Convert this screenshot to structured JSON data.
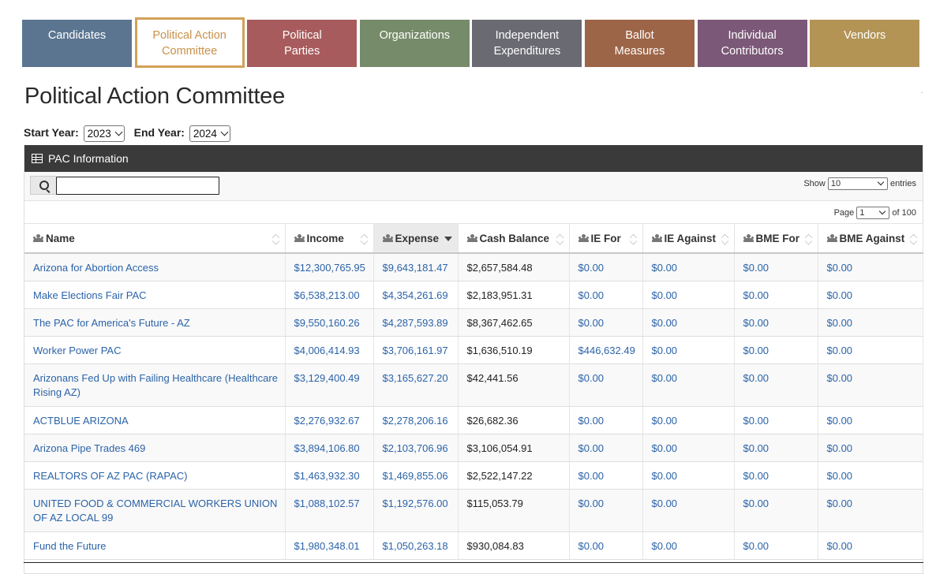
{
  "nav_tabs": [
    {
      "label": "Candidates",
      "color": "#5b7591",
      "active": false
    },
    {
      "label": "Political Action\nCommittee",
      "color": "#ffffff",
      "active": true
    },
    {
      "label": "Political\nParties",
      "color": "#a85b5c",
      "active": false
    },
    {
      "label": "Organizations",
      "color": "#768b6a",
      "active": false
    },
    {
      "label": "Independent\nExpenditures",
      "color": "#6a6a72",
      "active": false
    },
    {
      "label": "Ballot\nMeasures",
      "color": "#9d6547",
      "active": false
    },
    {
      "label": "Individual\nContributors",
      "color": "#7b5877",
      "active": false
    },
    {
      "label": "Vendors",
      "color": "#b39455",
      "active": false
    }
  ],
  "page_title": "Political Action Committee",
  "filters": {
    "start_label": "Start Year:",
    "start_value": "2023",
    "end_label": "End Year:",
    "end_value": "2024"
  },
  "panel": {
    "title": "PAC Information",
    "show_label": "Show",
    "show_value": "10",
    "entries_label": "entries",
    "page_label": "Page",
    "page_value": "1",
    "page_of": "of 100"
  },
  "table": {
    "columns": [
      "Name",
      "Income",
      "Expense",
      "Cash Balance",
      "IE For",
      "IE Against",
      "BME For",
      "BME Against"
    ],
    "sorted_column": "Expense",
    "rows": [
      {
        "name": "Arizona for Abortion Access",
        "income": "$12,300,765.95",
        "expense": "$9,643,181.47",
        "cash": "$2,657,584.48",
        "ie_for": "$0.00",
        "ie_against": "$0.00",
        "bme_for": "$0.00",
        "bme_against": "$0.00"
      },
      {
        "name": "Make Elections Fair PAC",
        "income": "$6,538,213.00",
        "expense": "$4,354,261.69",
        "cash": "$2,183,951.31",
        "ie_for": "$0.00",
        "ie_against": "$0.00",
        "bme_for": "$0.00",
        "bme_against": "$0.00"
      },
      {
        "name": "The PAC for America's Future - AZ",
        "income": "$9,550,160.26",
        "expense": "$4,287,593.89",
        "cash": "$8,367,462.65",
        "ie_for": "$0.00",
        "ie_against": "$0.00",
        "bme_for": "$0.00",
        "bme_against": "$0.00"
      },
      {
        "name": "Worker Power PAC",
        "income": "$4,006,414.93",
        "expense": "$3,706,161.97",
        "cash": "$1,636,510.19",
        "ie_for": "$446,632.49",
        "ie_against": "$0.00",
        "bme_for": "$0.00",
        "bme_against": "$0.00"
      },
      {
        "name": "Arizonans Fed Up with Failing Healthcare (Healthcare Rising AZ)",
        "income": "$3,129,400.49",
        "expense": "$3,165,627.20",
        "cash": "$42,441.56",
        "ie_for": "$0.00",
        "ie_against": "$0.00",
        "bme_for": "$0.00",
        "bme_against": "$0.00"
      },
      {
        "name": "ACTBLUE ARIZONA",
        "income": "$2,276,932.67",
        "expense": "$2,278,206.16",
        "cash": "$26,682.36",
        "ie_for": "$0.00",
        "ie_against": "$0.00",
        "bme_for": "$0.00",
        "bme_against": "$0.00"
      },
      {
        "name": "Arizona Pipe Trades 469",
        "income": "$3,894,106.80",
        "expense": "$2,103,706.96",
        "cash": "$3,106,054.91",
        "ie_for": "$0.00",
        "ie_against": "$0.00",
        "bme_for": "$0.00",
        "bme_against": "$0.00"
      },
      {
        "name": "REALTORS OF AZ PAC (RAPAC)",
        "income": "$1,463,932.30",
        "expense": "$1,469,855.06",
        "cash": "$2,522,147.22",
        "ie_for": "$0.00",
        "ie_against": "$0.00",
        "bme_for": "$0.00",
        "bme_against": "$0.00"
      },
      {
        "name": "UNITED FOOD & COMMERCIAL WORKERS UNION OF AZ LOCAL 99",
        "income": "$1,088,102.57",
        "expense": "$1,192,576.00",
        "cash": "$115,053.79",
        "ie_for": "$0.00",
        "ie_against": "$0.00",
        "bme_for": "$0.00",
        "bme_against": "$0.00"
      },
      {
        "name": "Fund the Future",
        "income": "$1,980,348.01",
        "expense": "$1,050,263.18",
        "cash": "$930,084.83",
        "ie_for": "$0.00",
        "ie_against": "$0.00",
        "bme_for": "$0.00",
        "bme_against": "$0.00"
      }
    ]
  }
}
